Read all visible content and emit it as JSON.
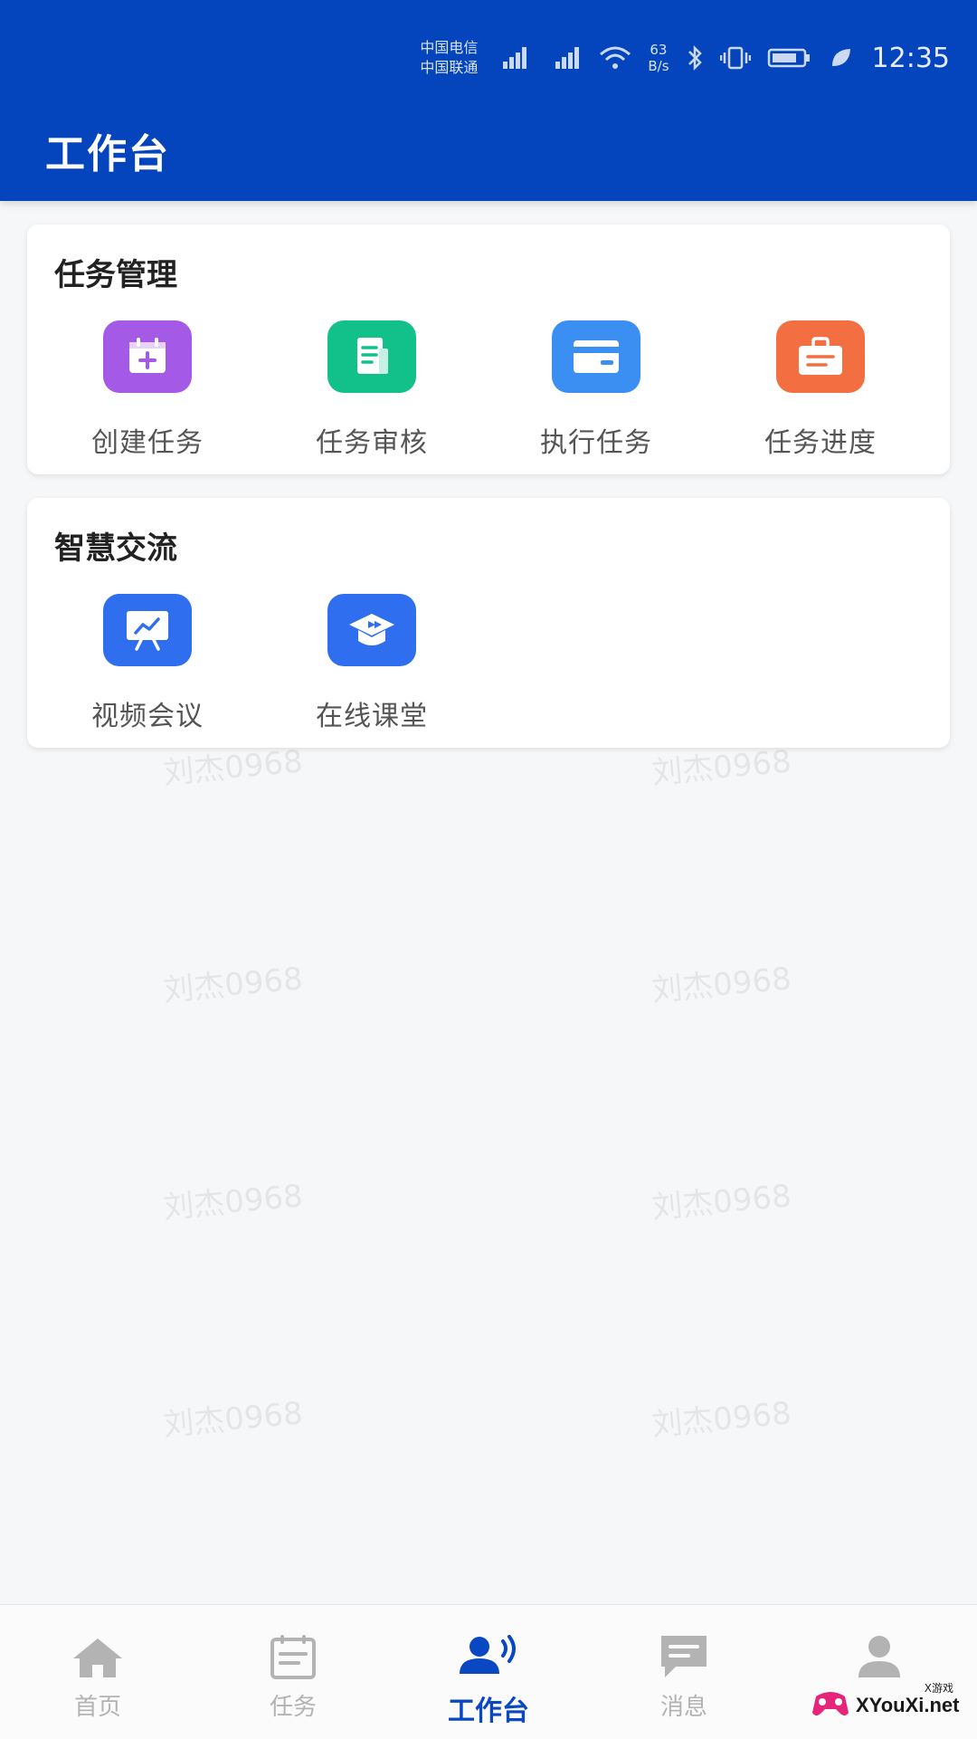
{
  "status_bar": {
    "carrier_1": "中国电信",
    "carrier_2": "中国联通",
    "net_speed_value": "63",
    "net_speed_unit": "B/s",
    "time": "12:35"
  },
  "header": {
    "title": "工作台"
  },
  "task_card": {
    "title": "任务管理",
    "items": [
      {
        "label": "创建任务",
        "icon": "calendar-add-icon",
        "color": "#a45ae6"
      },
      {
        "label": "任务审核",
        "icon": "document-icon",
        "color": "#12c08a"
      },
      {
        "label": "执行任务",
        "icon": "card-icon",
        "color": "#3b8ff3"
      },
      {
        "label": "任务进度",
        "icon": "briefcase-icon",
        "color": "#f36f42"
      }
    ]
  },
  "comm_card": {
    "title": "智慧交流",
    "items": [
      {
        "label": "视频会议",
        "icon": "presentation-icon",
        "color": "#2f6fef"
      },
      {
        "label": "在线课堂",
        "icon": "graduation-cap-icon",
        "color": "#2f6fef"
      }
    ]
  },
  "watermark": "刘杰0968",
  "bottom_nav": {
    "active_color": "#0a47c2",
    "inactive_color": "#b3b3b3",
    "items": [
      {
        "label": "首页",
        "icon": "home-icon"
      },
      {
        "label": "任务",
        "icon": "task-list-icon"
      },
      {
        "label": "工作台",
        "icon": "workbench-icon",
        "active": true
      },
      {
        "label": "消息",
        "icon": "message-icon"
      },
      {
        "label": "",
        "icon": "user-icon"
      }
    ]
  },
  "corner_logo": {
    "text": "XYouXi.net",
    "small_text": "X游戏"
  }
}
